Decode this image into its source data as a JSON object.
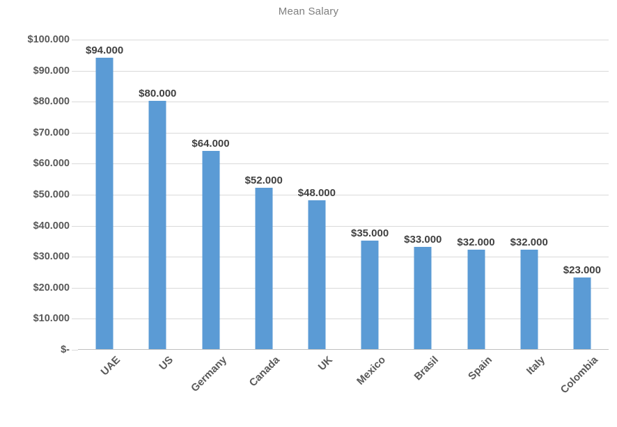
{
  "chart_data": {
    "type": "bar",
    "title": "Mean Salary",
    "xlabel": "",
    "ylabel": "",
    "categories": [
      "UAE",
      "US",
      "Germany",
      "Canada",
      "UK",
      "Mexico",
      "Brasil",
      "Spain",
      "Italy",
      "Colombia"
    ],
    "values": [
      94000,
      80000,
      64000,
      52000,
      48000,
      35000,
      33000,
      32000,
      32000,
      23000
    ],
    "data_labels": [
      "$94.000",
      "$80.000",
      "$64.000",
      "$52.000",
      "$48.000",
      "$35.000",
      "$33.000",
      "$32.000",
      "$32.000",
      "$23.000"
    ],
    "ylim": [
      0,
      100000
    ],
    "y_tick_values": [
      100000,
      90000,
      80000,
      70000,
      60000,
      50000,
      40000,
      30000,
      20000,
      10000,
      0
    ],
    "y_tick_labels": [
      "$100.000",
      "$90.000",
      "$80.000",
      "$70.000",
      "$60.000",
      "$50.000",
      "$40.000",
      "$30.000",
      "$20.000",
      "$10.000",
      "$-"
    ],
    "grid": true,
    "legend": false,
    "legend_position": "none",
    "bar_color": "#5b9bd5",
    "gridline_color": "#d9d9d9",
    "axis_line_color": "#bfbfbf",
    "title_color": "#7f7f7f",
    "tick_label_color": "#595959",
    "data_label_color": "#404040",
    "background_color": "#ffffff",
    "x_label_rotation": -45
  }
}
